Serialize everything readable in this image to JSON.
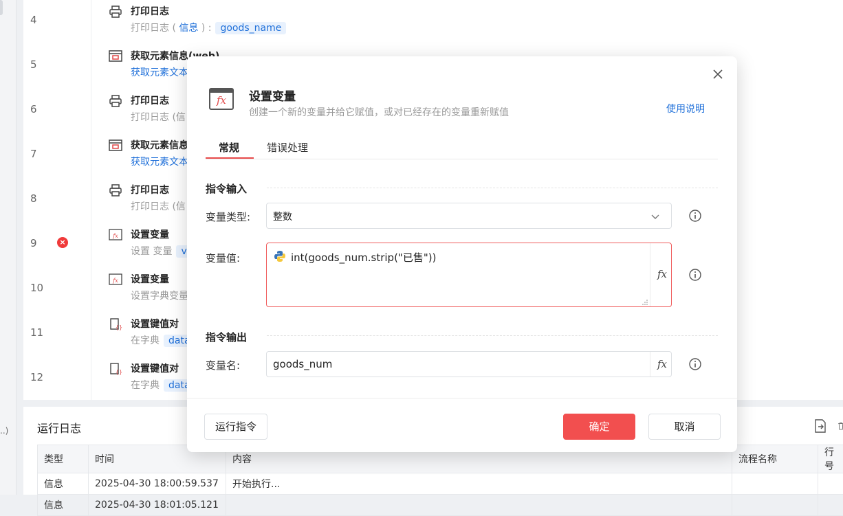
{
  "editor": {
    "left_truncated": "..)",
    "rows": [
      {
        "num": "4",
        "title": "打印日志",
        "sub_pre": "打印日志 (",
        "sub_mid": "信息",
        "sub_post": ") :",
        "chip": "goods_name"
      },
      {
        "num": "5",
        "title": "获取元素信息(web)",
        "sub": "获取元素文本"
      },
      {
        "num": "6",
        "title": "打印日志",
        "sub": "打印日志 (信"
      },
      {
        "num": "7",
        "title": "获取元素信息",
        "sub": "获取元素文本"
      },
      {
        "num": "8",
        "title": "打印日志",
        "sub": "打印日志 (信"
      },
      {
        "num": "9",
        "title": "设置变量",
        "sub": "设置 变量",
        "chip": "v"
      },
      {
        "num": "10",
        "title": "设置变量",
        "sub": "设置字典变量"
      },
      {
        "num": "11",
        "title": "设置键值对",
        "sub": "在字典",
        "chip": "data"
      },
      {
        "num": "12",
        "title": "设置键值对",
        "sub": "在字典",
        "chip": "data"
      }
    ]
  },
  "log": {
    "title": "运行日志",
    "columns": [
      "类型",
      "时间",
      "内容",
      "流程名称",
      "行号"
    ],
    "rows": [
      [
        "信息",
        "2025-04-30 18:00:59.537",
        "开始执行...",
        "",
        ""
      ],
      [
        "信息",
        "2025-04-30 18:01:05.121",
        "",
        "",
        ""
      ]
    ]
  },
  "modal": {
    "title": "设置变量",
    "subtitle": "创建一个新的变量并给它赋值，或对已经存在的变量重新赋值",
    "help_link": "使用说明",
    "icon_text": "fx",
    "tabs": [
      "常规",
      "错误处理"
    ],
    "section_input": "指令输入",
    "section_output": "指令输出",
    "type_label": "变量类型:",
    "type_value": "整数",
    "value_label": "变量值:",
    "value_code": "int(goods_num.strip(\"已售\"))",
    "name_label": "变量名:",
    "name_value": "goods_num",
    "fx_symbol": "fx",
    "buttons": {
      "run": "运行指令",
      "ok": "确定",
      "cancel": "取消"
    }
  },
  "colors": {
    "accent_red": "#f24f4f",
    "link_blue": "#1e6fd9"
  }
}
